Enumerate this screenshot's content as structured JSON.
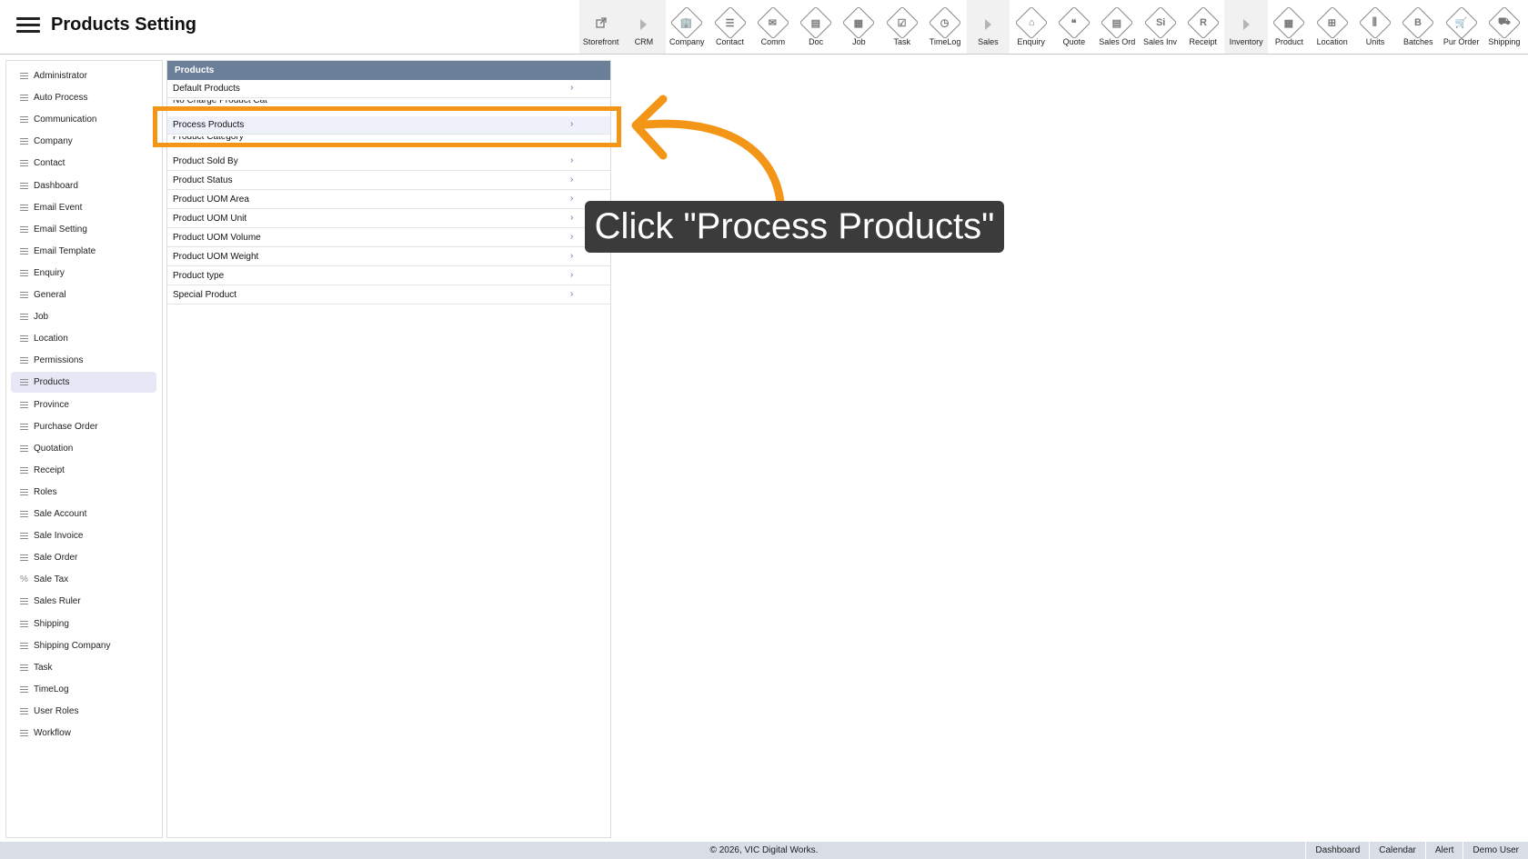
{
  "header": {
    "title": "Products Setting",
    "toolbar": [
      {
        "label": "Storefront",
        "icon": "external-link-icon",
        "kind": "plain",
        "shaded": true
      },
      {
        "label": "CRM",
        "icon": "play-arrow-icon",
        "kind": "tri",
        "shaded": true
      },
      {
        "label": "Company",
        "icon": "company-icon",
        "kind": "diamond",
        "glyph": "🏢"
      },
      {
        "label": "Contact",
        "icon": "contact-card-icon",
        "kind": "diamond",
        "glyph": "☰"
      },
      {
        "label": "Comm",
        "icon": "comm-icon",
        "kind": "diamond",
        "glyph": "✉"
      },
      {
        "label": "Doc",
        "icon": "document-icon",
        "kind": "diamond",
        "glyph": "▤"
      },
      {
        "label": "Job",
        "icon": "job-icon",
        "kind": "diamond",
        "glyph": "▦"
      },
      {
        "label": "Task",
        "icon": "task-clipboard-icon",
        "kind": "diamond",
        "glyph": "☑"
      },
      {
        "label": "TimeLog",
        "icon": "clock-icon",
        "kind": "diamond",
        "glyph": "◷"
      },
      {
        "label": "Sales",
        "icon": "play-arrow-icon",
        "kind": "tri",
        "shaded": true
      },
      {
        "label": "Enquiry",
        "icon": "enquiry-icon",
        "kind": "diamond",
        "glyph": "⌂"
      },
      {
        "label": "Quote",
        "icon": "quote-icon",
        "kind": "diamond",
        "glyph": "❝"
      },
      {
        "label": "Sales Ord",
        "icon": "sales-order-icon",
        "kind": "diamond",
        "glyph": "▤"
      },
      {
        "label": "Sales Inv",
        "icon": "sales-invoice-icon",
        "kind": "diamond",
        "glyph": "Si"
      },
      {
        "label": "Receipt",
        "icon": "receipt-icon",
        "kind": "diamond",
        "glyph": "R"
      },
      {
        "label": "Inventory",
        "icon": "play-arrow-icon",
        "kind": "tri",
        "shaded": true
      },
      {
        "label": "Product",
        "icon": "product-icon",
        "kind": "diamond",
        "glyph": "▦"
      },
      {
        "label": "Location",
        "icon": "location-icon",
        "kind": "diamond",
        "glyph": "⊞"
      },
      {
        "label": "Units",
        "icon": "units-icon",
        "kind": "diamond",
        "glyph": "⫼"
      },
      {
        "label": "Batches",
        "icon": "batches-icon",
        "kind": "diamond",
        "glyph": "B"
      },
      {
        "label": "Pur Order",
        "icon": "cart-icon",
        "kind": "diamond",
        "glyph": "🛒"
      },
      {
        "label": "Shipping",
        "icon": "truck-icon",
        "kind": "diamond",
        "glyph": "⛟"
      }
    ]
  },
  "sidebar": {
    "items": [
      {
        "label": "Administrator"
      },
      {
        "label": "Auto Process"
      },
      {
        "label": "Communication"
      },
      {
        "label": "Company"
      },
      {
        "label": "Contact"
      },
      {
        "label": "Dashboard"
      },
      {
        "label": "Email Event"
      },
      {
        "label": "Email Setting"
      },
      {
        "label": "Email Template"
      },
      {
        "label": "Enquiry"
      },
      {
        "label": "General"
      },
      {
        "label": "Job"
      },
      {
        "label": "Location"
      },
      {
        "label": "Permissions"
      },
      {
        "label": "Products",
        "active": true
      },
      {
        "label": "Province"
      },
      {
        "label": "Purchase Order"
      },
      {
        "label": "Quotation"
      },
      {
        "label": "Receipt"
      },
      {
        "label": "Roles"
      },
      {
        "label": "Sale Account"
      },
      {
        "label": "Sale Invoice"
      },
      {
        "label": "Sale Order"
      },
      {
        "label": "Sale Tax",
        "icon": "percent"
      },
      {
        "label": "Sales Ruler"
      },
      {
        "label": "Shipping"
      },
      {
        "label": "Shipping Company"
      },
      {
        "label": "Task"
      },
      {
        "label": "TimeLog"
      },
      {
        "label": "User Roles"
      },
      {
        "label": "Workflow"
      }
    ]
  },
  "panel": {
    "title": "Products",
    "rows": [
      {
        "label": "Default Products"
      },
      {
        "label": "No Charge Product Cat",
        "partial": true
      },
      {
        "label": "Process Products",
        "highlight": true
      },
      {
        "label": "Product Category",
        "partial": true
      },
      {
        "label": "Product Sold By"
      },
      {
        "label": "Product Status"
      },
      {
        "label": "Product UOM Area"
      },
      {
        "label": "Product UOM Unit"
      },
      {
        "label": "Product UOM Volume"
      },
      {
        "label": "Product UOM Weight"
      },
      {
        "label": "Product type"
      },
      {
        "label": "Special Product"
      }
    ]
  },
  "callout": {
    "text": "Click \"Process Products\"",
    "accent_color": "#f39617"
  },
  "footer": {
    "copyright": "© 2026, VIC Digital Works.",
    "links": [
      "Dashboard",
      "Calendar",
      "Alert",
      "Demo User"
    ]
  }
}
